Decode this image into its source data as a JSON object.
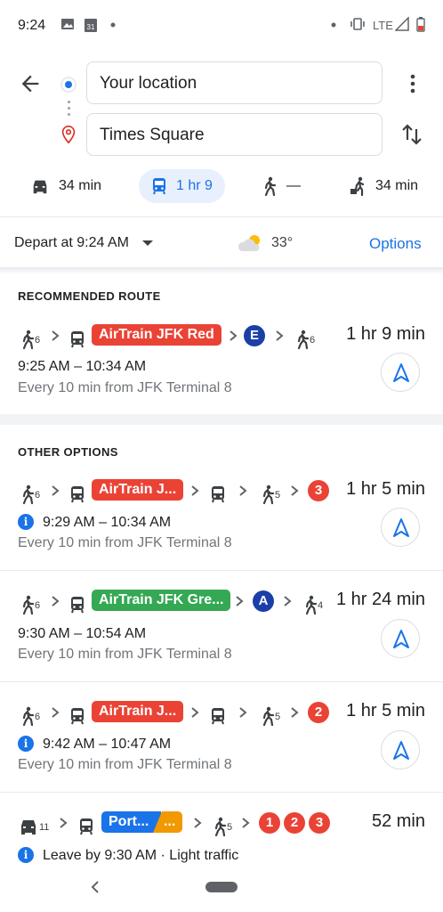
{
  "status_bar": {
    "time": "9:24",
    "network": "LTE"
  },
  "search": {
    "origin": "Your location",
    "destination": "Times Square"
  },
  "modes": [
    {
      "icon": "car-icon",
      "label": "34 min"
    },
    {
      "icon": "transit-icon",
      "label": "1 hr 9",
      "active": true
    },
    {
      "icon": "walk-icon",
      "label": "—"
    },
    {
      "icon": "rideshare-icon",
      "label": "34 min"
    }
  ],
  "depart": {
    "label": "Depart at 9:24 AM",
    "weather_temp": "33°",
    "options_label": "Options"
  },
  "recommended": {
    "title": "RECOMMENDED ROUTE",
    "walk1": "6",
    "line": "AirTrain JFK Red",
    "subway": "E",
    "walk2": "6",
    "duration": "1 hr 9 min",
    "times": "9:25 AM – 10:34 AM",
    "frequency": "Every 10 min from JFK Terminal 8"
  },
  "other": {
    "title": "OTHER OPTIONS",
    "routes": [
      {
        "walk1": "6",
        "line": "AirTrain J...",
        "walk2": "5",
        "subway": "3",
        "duration": "1 hr 5 min",
        "times": "9:29 AM – 10:34 AM",
        "frequency": "Every 10 min from JFK Terminal 8",
        "info": true
      },
      {
        "walk1": "6",
        "line": "AirTrain JFK Gre...",
        "subway": "A",
        "walk2": "4",
        "duration": "1 hr 24 min",
        "times": "9:30 AM – 10:54 AM",
        "frequency": "Every 10 min from JFK Terminal 8",
        "info": false
      },
      {
        "walk1": "6",
        "line": "AirTrain J...",
        "walk2": "5",
        "subway": "2",
        "duration": "1 hr 5 min",
        "times": "9:42 AM – 10:47 AM",
        "frequency": "Every 10 min from JFK Terminal 8",
        "info": true
      },
      {
        "drive": "11",
        "line": "Port...",
        "line2": "...",
        "walk": "5",
        "subways": [
          "1",
          "2",
          "3"
        ],
        "duration": "52 min",
        "note": "Leave by 9:30 AM · Light traffic"
      }
    ]
  },
  "colors": {
    "accent": "#1a73e8",
    "airtrain_red": "#ea4335",
    "airtrain_green": "#34a853",
    "subway_red": "#ea4335",
    "subway_blue": "#1a3fa8",
    "port_blue": "#1a73e8",
    "port_orange": "#f29900"
  }
}
